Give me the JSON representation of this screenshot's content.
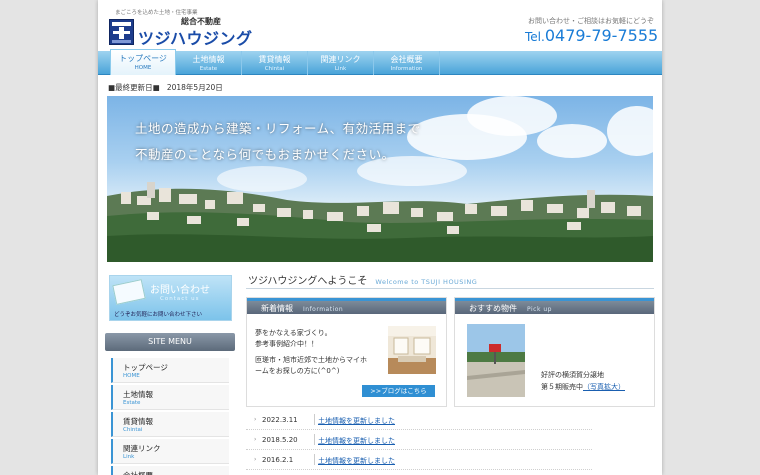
{
  "header": {
    "tagline": "まごころを込めた土地・住宅事業",
    "logo_sub": "総合不動産",
    "logo_name": "ツジハウジング",
    "contact_note": "お問い合わせ・ご相談はお気軽にどうぞ",
    "tel_label": "Tel.",
    "tel_number": "0479-79-7555"
  },
  "nav": {
    "items": [
      {
        "jp": "トップページ",
        "en": "HOME"
      },
      {
        "jp": "土地情報",
        "en": "Estate"
      },
      {
        "jp": "賃貸情報",
        "en": "Chintai"
      },
      {
        "jp": "関連リンク",
        "en": "Link"
      },
      {
        "jp": "会社概要",
        "en": "Information"
      }
    ]
  },
  "update": {
    "label": "■最終更新日■",
    "date": "2018年5月20日"
  },
  "hero": {
    "line1": "土地の造成から建築・リフォーム、有効活用まで",
    "line2": "不動産のことなら何でもおまかせください。"
  },
  "sidebar": {
    "contact_title": "お問い合わせ",
    "contact_en": "Contact us",
    "contact_note": "どうぞお気軽にお問い合わせ下さい",
    "menu_title": "SITE MENU",
    "menu": [
      {
        "jp": "トップページ",
        "en": "HOME"
      },
      {
        "jp": "土地情報",
        "en": "Estate"
      },
      {
        "jp": "賃貸情報",
        "en": "Chintai"
      },
      {
        "jp": "関連リンク",
        "en": "Link"
      },
      {
        "jp": "会社概要",
        "en": ""
      }
    ]
  },
  "main": {
    "welcome_jp": "ツジハウジングへようこそ",
    "welcome_en": "Welcome to TSUJI HOUSING",
    "news_box": {
      "title": "新着情報",
      "title_en": "Information",
      "line1": "夢をかなえる家づくり。",
      "line2": "参考事例紹介中！！",
      "line3": "匝瑳市・旭市近郊で土地からマイホ",
      "line4": "ームをお探しの方に(^0^)",
      "blog_button": ">>ブログはこちら"
    },
    "pickup_box": {
      "title": "おすすめ物件",
      "title_en": "Pick up",
      "line1": "好評の横須賀分譲地",
      "line2": "第５期販売中",
      "link": "（写真拡大）"
    },
    "news": [
      {
        "date": "2022.3.11",
        "text": "土地情報を更新しました"
      },
      {
        "date": "2018.5.20",
        "text": "土地情報を更新しました"
      },
      {
        "date": "2016.2.1",
        "text": "土地情報を更新しました"
      }
    ]
  }
}
